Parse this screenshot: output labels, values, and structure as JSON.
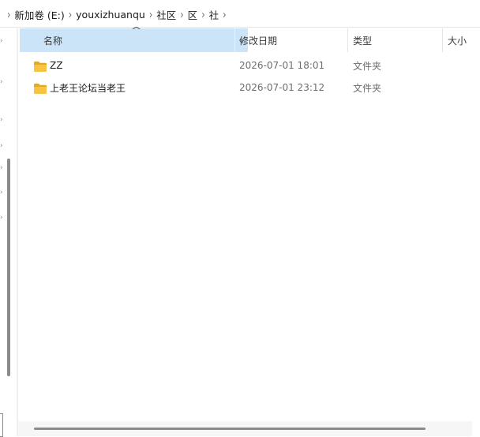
{
  "breadcrumb": {
    "items": [
      {
        "label": "新加卷 (E:)"
      },
      {
        "label": "youxizhuanqu"
      },
      {
        "label": "社区"
      },
      {
        "label": "区"
      },
      {
        "label": "社"
      }
    ]
  },
  "columns": {
    "name": "名称",
    "date": "修改日期",
    "type": "类型",
    "size": "大小",
    "sort_indicator": "^"
  },
  "files": [
    {
      "name": "ZZ",
      "date": "2026-07-01 18:01",
      "type": "文件夹",
      "icon": "folder-icon"
    },
    {
      "name": "上老王论坛当老王",
      "date": "2026-07-01 23:12",
      "type": "文件夹",
      "icon": "folder-icon"
    }
  ],
  "colors": {
    "header_selected": "#cce4f7",
    "folder": "#f6c343",
    "folder_dark": "#e0a92a"
  }
}
